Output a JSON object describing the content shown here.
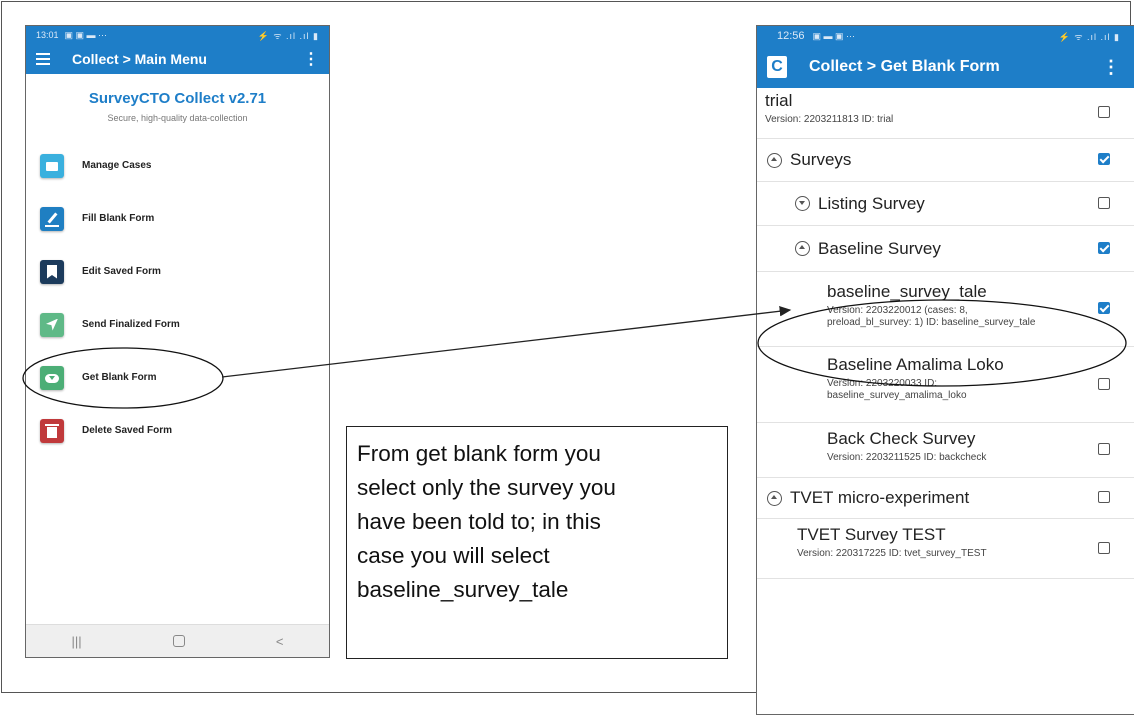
{
  "left_phone": {
    "status_time": "13:01",
    "status_icons": "▣ ▣ ▬ ⋯",
    "status_right": "⚡ ᯤ .ıl .ıl ▮",
    "app_title": "Collect > Main Menu",
    "kebab": "⋮",
    "brand_name": "SurveyCTO Collect v2.71",
    "brand_tagline": "Secure, high-quality data-collection",
    "menu": [
      {
        "label": "Manage Cases",
        "color": "#3ab0de"
      },
      {
        "label": "Fill Blank Form",
        "color": "#1f7fc2"
      },
      {
        "label": "Edit Saved Form",
        "color": "#1c3b5c"
      },
      {
        "label": "Send Finalized Form",
        "color": "#5fb987"
      },
      {
        "label": "Get Blank Form",
        "color": "#4cae76"
      },
      {
        "label": "Delete Saved Form",
        "color": "#c0393b"
      }
    ],
    "nav": {
      "recents": "|||",
      "back": "<"
    }
  },
  "right_phone": {
    "status_time": "12:56",
    "status_icons": "▣ ▬ ▣ ⋯",
    "status_right": "⚡ ᯤ .ıl .ıl ▮",
    "badge": "C",
    "app_title": "Collect > Get Blank Form",
    "kebab": "⋮",
    "rows": {
      "trial": {
        "title": "trial",
        "sub": "Version: 2203211813 ID: trial",
        "checked": false
      },
      "surveys": {
        "title": "Surveys",
        "checked": true
      },
      "listing": {
        "title": "Listing Survey",
        "checked": false
      },
      "baseline": {
        "title": "Baseline Survey",
        "checked": true
      },
      "tale": {
        "title": "baseline_survey_tale",
        "sub1": "Version: 2203220012 (cases: 8,",
        "sub2": "preload_bl_survey: 1) ID: baseline_survey_tale",
        "checked": true
      },
      "amalima": {
        "title": "Baseline Amalima Loko",
        "sub1": "Version: 2203220033 ID:",
        "sub2": "baseline_survey_amalima_loko",
        "checked": false
      },
      "backcheck": {
        "title": "Back Check Survey",
        "sub": "Version: 2203211525 ID: backcheck",
        "checked": false
      },
      "tvet": {
        "title": "TVET micro-experiment",
        "checked": false
      },
      "tvet_test": {
        "title": "TVET Survey TEST",
        "sub": "Version: 220317225 ID: tvet_survey_TEST",
        "checked": false
      }
    }
  },
  "callout": {
    "lines": [
      "From get blank form you",
      "select only the survey you",
      "have been told to; in this",
      "case you will select",
      "baseline_survey_tale"
    ]
  }
}
